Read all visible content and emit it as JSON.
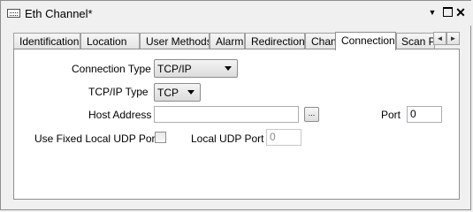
{
  "window": {
    "title": "Eth Channel*",
    "dropdown_glyph": "▼",
    "close_glyph": "✕"
  },
  "tabs": [
    {
      "label": "Identification",
      "active": false
    },
    {
      "label": "Location",
      "active": false
    },
    {
      "label": "User Methods",
      "active": false
    },
    {
      "label": "Alarm",
      "active": false
    },
    {
      "label": "Redirection",
      "active": false
    },
    {
      "label": "Channel",
      "active": false
    },
    {
      "label": "Connection",
      "active": true
    },
    {
      "label": "Scan Pa",
      "active": false
    }
  ],
  "tab_scroll": {
    "left": "◄",
    "right": "►"
  },
  "form": {
    "connection_type": {
      "label": "Connection Type",
      "value": "TCP/IP"
    },
    "tcpip_type": {
      "label": "TCP/IP Type",
      "value": "TCP"
    },
    "host_address": {
      "label": "Host Address",
      "value": "",
      "browse_label": "..."
    },
    "port": {
      "label": "Port",
      "value": "0"
    },
    "fixed_local_udp": {
      "label": "Use Fixed Local UDP Port",
      "checked": false
    },
    "local_udp_port": {
      "label": "Local UDP Port",
      "value": "0"
    }
  },
  "icons": {
    "window_icon": "channel-icon",
    "dropdown": "chevron-down-icon",
    "maximize": "maximize-icon",
    "close": "close-icon"
  }
}
